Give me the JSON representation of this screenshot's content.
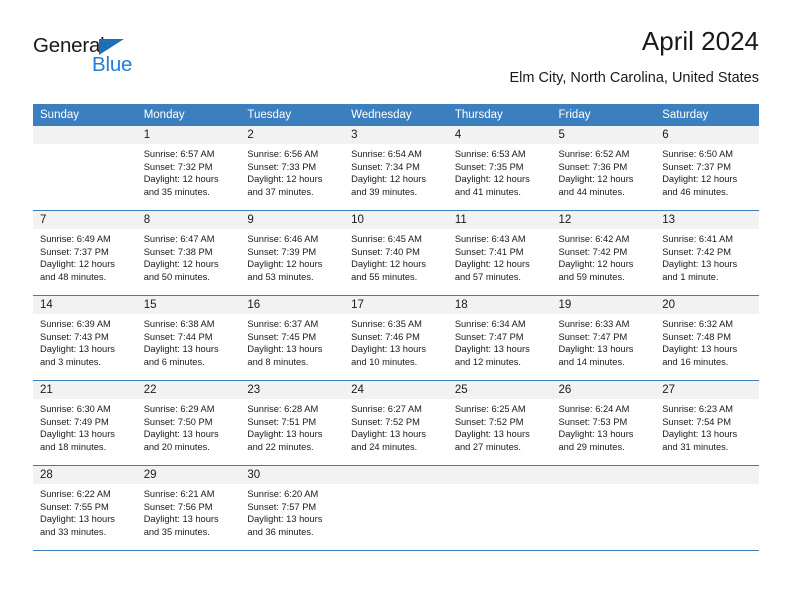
{
  "brand": {
    "name_part1": "General",
    "name_part2": "Blue",
    "triangle_icon": "blue-triangle-icon",
    "colors": {
      "dark": "#1a1a1a",
      "blue": "#2180d4",
      "triangle": "#1e6fb5"
    }
  },
  "header": {
    "title": "April 2024",
    "subtitle": "Elm City, North Carolina, United States"
  },
  "theme": {
    "header_bg": "#3c7fbf",
    "header_text": "#ffffff",
    "daynum_bg": "#f2f2f2",
    "separator": "#3c7fbf",
    "body_text": "#1a1a1a"
  },
  "columns": [
    "Sunday",
    "Monday",
    "Tuesday",
    "Wednesday",
    "Thursday",
    "Friday",
    "Saturday"
  ],
  "weeks": [
    [
      {
        "day": "",
        "lines": []
      },
      {
        "day": "1",
        "lines": [
          "Sunrise: 6:57 AM",
          "Sunset: 7:32 PM",
          "Daylight: 12 hours",
          "and 35 minutes."
        ]
      },
      {
        "day": "2",
        "lines": [
          "Sunrise: 6:56 AM",
          "Sunset: 7:33 PM",
          "Daylight: 12 hours",
          "and 37 minutes."
        ]
      },
      {
        "day": "3",
        "lines": [
          "Sunrise: 6:54 AM",
          "Sunset: 7:34 PM",
          "Daylight: 12 hours",
          "and 39 minutes."
        ]
      },
      {
        "day": "4",
        "lines": [
          "Sunrise: 6:53 AM",
          "Sunset: 7:35 PM",
          "Daylight: 12 hours",
          "and 41 minutes."
        ]
      },
      {
        "day": "5",
        "lines": [
          "Sunrise: 6:52 AM",
          "Sunset: 7:36 PM",
          "Daylight: 12 hours",
          "and 44 minutes."
        ]
      },
      {
        "day": "6",
        "lines": [
          "Sunrise: 6:50 AM",
          "Sunset: 7:37 PM",
          "Daylight: 12 hours",
          "and 46 minutes."
        ]
      }
    ],
    [
      {
        "day": "7",
        "lines": [
          "Sunrise: 6:49 AM",
          "Sunset: 7:37 PM",
          "Daylight: 12 hours",
          "and 48 minutes."
        ]
      },
      {
        "day": "8",
        "lines": [
          "Sunrise: 6:47 AM",
          "Sunset: 7:38 PM",
          "Daylight: 12 hours",
          "and 50 minutes."
        ]
      },
      {
        "day": "9",
        "lines": [
          "Sunrise: 6:46 AM",
          "Sunset: 7:39 PM",
          "Daylight: 12 hours",
          "and 53 minutes."
        ]
      },
      {
        "day": "10",
        "lines": [
          "Sunrise: 6:45 AM",
          "Sunset: 7:40 PM",
          "Daylight: 12 hours",
          "and 55 minutes."
        ]
      },
      {
        "day": "11",
        "lines": [
          "Sunrise: 6:43 AM",
          "Sunset: 7:41 PM",
          "Daylight: 12 hours",
          "and 57 minutes."
        ]
      },
      {
        "day": "12",
        "lines": [
          "Sunrise: 6:42 AM",
          "Sunset: 7:42 PM",
          "Daylight: 12 hours",
          "and 59 minutes."
        ]
      },
      {
        "day": "13",
        "lines": [
          "Sunrise: 6:41 AM",
          "Sunset: 7:42 PM",
          "Daylight: 13 hours",
          "and 1 minute."
        ]
      }
    ],
    [
      {
        "day": "14",
        "lines": [
          "Sunrise: 6:39 AM",
          "Sunset: 7:43 PM",
          "Daylight: 13 hours",
          "and 3 minutes."
        ]
      },
      {
        "day": "15",
        "lines": [
          "Sunrise: 6:38 AM",
          "Sunset: 7:44 PM",
          "Daylight: 13 hours",
          "and 6 minutes."
        ]
      },
      {
        "day": "16",
        "lines": [
          "Sunrise: 6:37 AM",
          "Sunset: 7:45 PM",
          "Daylight: 13 hours",
          "and 8 minutes."
        ]
      },
      {
        "day": "17",
        "lines": [
          "Sunrise: 6:35 AM",
          "Sunset: 7:46 PM",
          "Daylight: 13 hours",
          "and 10 minutes."
        ]
      },
      {
        "day": "18",
        "lines": [
          "Sunrise: 6:34 AM",
          "Sunset: 7:47 PM",
          "Daylight: 13 hours",
          "and 12 minutes."
        ]
      },
      {
        "day": "19",
        "lines": [
          "Sunrise: 6:33 AM",
          "Sunset: 7:47 PM",
          "Daylight: 13 hours",
          "and 14 minutes."
        ]
      },
      {
        "day": "20",
        "lines": [
          "Sunrise: 6:32 AM",
          "Sunset: 7:48 PM",
          "Daylight: 13 hours",
          "and 16 minutes."
        ]
      }
    ],
    [
      {
        "day": "21",
        "lines": [
          "Sunrise: 6:30 AM",
          "Sunset: 7:49 PM",
          "Daylight: 13 hours",
          "and 18 minutes."
        ]
      },
      {
        "day": "22",
        "lines": [
          "Sunrise: 6:29 AM",
          "Sunset: 7:50 PM",
          "Daylight: 13 hours",
          "and 20 minutes."
        ]
      },
      {
        "day": "23",
        "lines": [
          "Sunrise: 6:28 AM",
          "Sunset: 7:51 PM",
          "Daylight: 13 hours",
          "and 22 minutes."
        ]
      },
      {
        "day": "24",
        "lines": [
          "Sunrise: 6:27 AM",
          "Sunset: 7:52 PM",
          "Daylight: 13 hours",
          "and 24 minutes."
        ]
      },
      {
        "day": "25",
        "lines": [
          "Sunrise: 6:25 AM",
          "Sunset: 7:52 PM",
          "Daylight: 13 hours",
          "and 27 minutes."
        ]
      },
      {
        "day": "26",
        "lines": [
          "Sunrise: 6:24 AM",
          "Sunset: 7:53 PM",
          "Daylight: 13 hours",
          "and 29 minutes."
        ]
      },
      {
        "day": "27",
        "lines": [
          "Sunrise: 6:23 AM",
          "Sunset: 7:54 PM",
          "Daylight: 13 hours",
          "and 31 minutes."
        ]
      }
    ],
    [
      {
        "day": "28",
        "lines": [
          "Sunrise: 6:22 AM",
          "Sunset: 7:55 PM",
          "Daylight: 13 hours",
          "and 33 minutes."
        ]
      },
      {
        "day": "29",
        "lines": [
          "Sunrise: 6:21 AM",
          "Sunset: 7:56 PM",
          "Daylight: 13 hours",
          "and 35 minutes."
        ]
      },
      {
        "day": "30",
        "lines": [
          "Sunrise: 6:20 AM",
          "Sunset: 7:57 PM",
          "Daylight: 13 hours",
          "and 36 minutes."
        ]
      },
      {
        "day": "",
        "lines": []
      },
      {
        "day": "",
        "lines": []
      },
      {
        "day": "",
        "lines": []
      },
      {
        "day": "",
        "lines": []
      }
    ]
  ]
}
